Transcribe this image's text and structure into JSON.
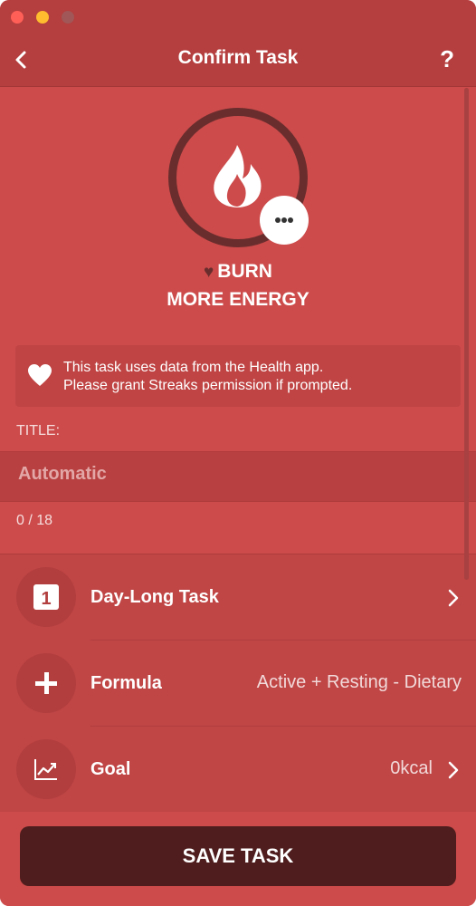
{
  "colors": {
    "background": "#cd4b4b",
    "header": "#b53e3e",
    "ring": "#6a2d2d",
    "save_button": "#4f1d1d"
  },
  "nav": {
    "title": "Confirm Task",
    "help_label": "?"
  },
  "hero": {
    "icon": "flame-icon",
    "line1": "BURN",
    "line2": "MORE ENERGY"
  },
  "health_note": {
    "line1": "This task uses data from the Health app.",
    "line2": "Please grant Streaks permission if prompted."
  },
  "title_field": {
    "label": "TITLE:",
    "placeholder": "Automatic",
    "value": "",
    "counter": "0 / 18"
  },
  "options": [
    {
      "label": "Day-Long Task",
      "value": "",
      "icon": "calendar-day-icon",
      "day_number": "1"
    },
    {
      "label": "Formula",
      "value": "Active + Resting - Dietary",
      "icon": "plus-icon"
    },
    {
      "label": "Goal",
      "value": "0kcal",
      "icon": "trend-chart-icon"
    }
  ],
  "save_button": "SAVE TASK"
}
